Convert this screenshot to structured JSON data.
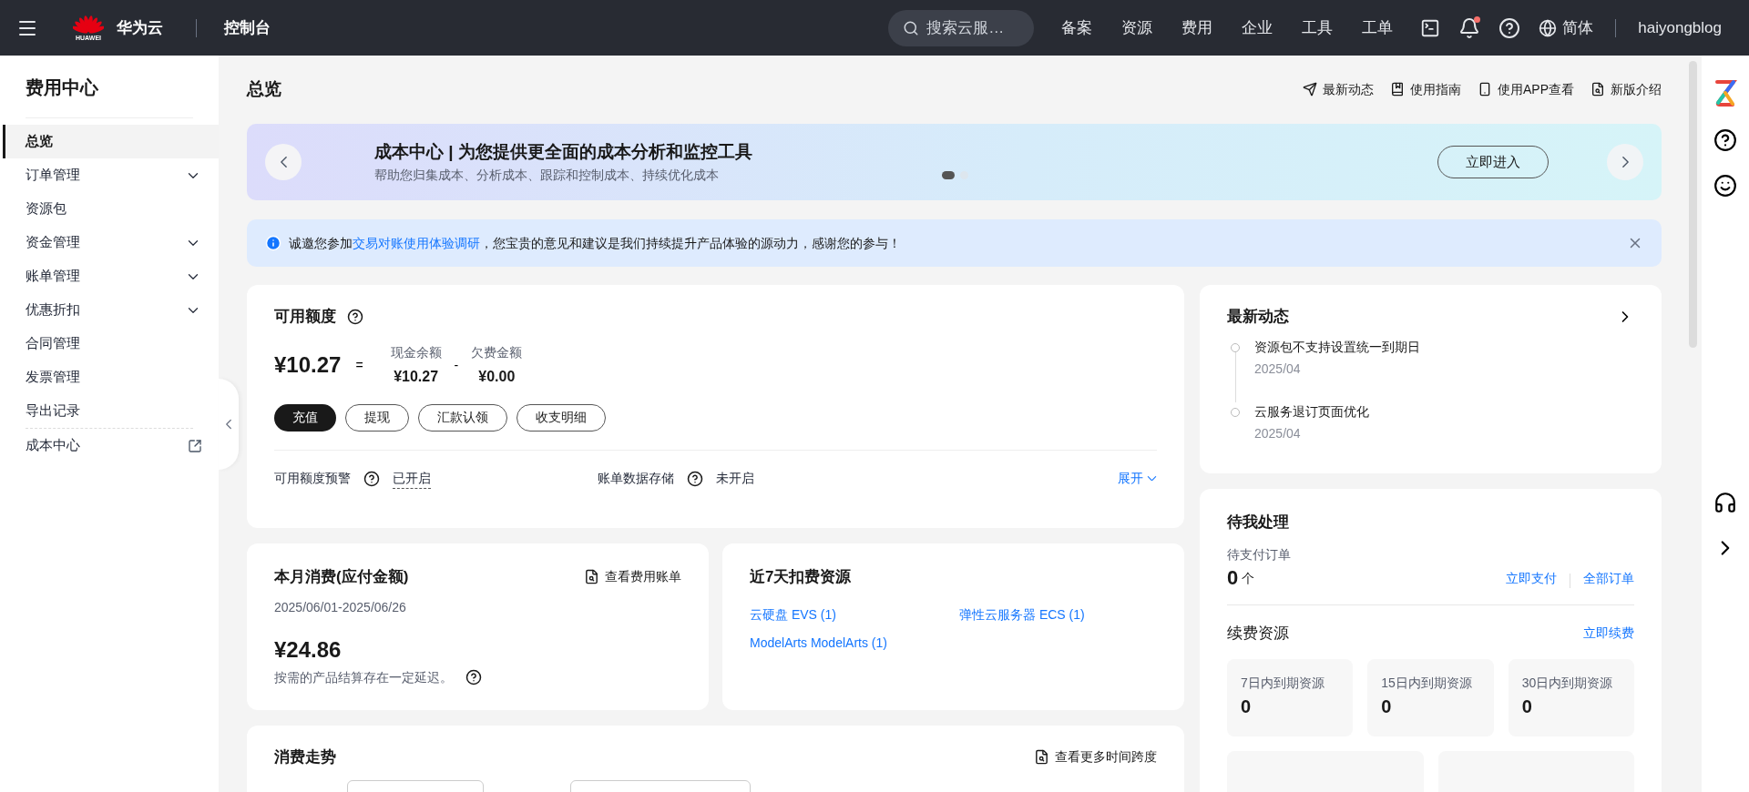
{
  "topbar": {
    "brand_mark": "HUAWEI",
    "brand": "华为云",
    "console": "控制台",
    "search": {
      "placeholder": "搜索云服…"
    },
    "nav": [
      "备案",
      "资源",
      "费用",
      "企业",
      "工具",
      "工单"
    ],
    "notifications": {
      "unread": true
    },
    "language": "简体",
    "user": "haiyongblog"
  },
  "sidebar": {
    "title": "费用中心",
    "items": [
      {
        "label": "总览",
        "kind": "plain",
        "selected": true
      },
      {
        "label": "订单管理",
        "kind": "group",
        "selected": false
      },
      {
        "label": "资源包",
        "kind": "plain",
        "selected": false
      },
      {
        "label": "资金管理",
        "kind": "group",
        "selected": false
      },
      {
        "label": "账单管理",
        "kind": "group",
        "selected": false
      },
      {
        "label": "优惠折扣",
        "kind": "group",
        "selected": false
      },
      {
        "label": "合同管理",
        "kind": "plain",
        "selected": false
      },
      {
        "label": "发票管理",
        "kind": "plain",
        "selected": false
      },
      {
        "label": "导出记录",
        "kind": "plain",
        "selected": false
      },
      {
        "label": "成本中心",
        "kind": "external",
        "selected": false
      }
    ]
  },
  "page": {
    "title": "总览",
    "header_links": [
      "最新动态",
      "使用指南",
      "使用APP查看",
      "新版介绍"
    ]
  },
  "banner": {
    "title": "成本中心 | 为您提供更全面的成本分析和监控工具",
    "subtitle": "帮助您归集成本、分析成本、跟踪和控制成本、持续优化成本",
    "button": "立即进入",
    "dots": [
      {
        "selected": true
      },
      {
        "selected": false
      }
    ]
  },
  "notice": {
    "before": "诚邀您参加",
    "link": "交易对账使用体验调研",
    "after": "，您宝贵的意见和建议是我们持续提升产品体验的源动力，感谢您的参与！"
  },
  "credit": {
    "title": "可用额度",
    "total": "¥10.27",
    "equals": "=",
    "minus": "-",
    "parts": [
      {
        "label": "现金余额",
        "value": "¥10.27"
      },
      {
        "label": "欠费金额",
        "value": "¥0.00"
      }
    ],
    "buttons": [
      {
        "label": "充值",
        "kind": "primary"
      },
      {
        "label": "提现",
        "kind": "outline"
      },
      {
        "label": "汇款认领",
        "kind": "outline"
      },
      {
        "label": "收支明细",
        "kind": "outline"
      }
    ],
    "settings": [
      {
        "label": "可用额度预警",
        "value": "已开启",
        "on": true
      },
      {
        "label": "账单数据存储",
        "value": "未开启",
        "on": false
      }
    ],
    "expand": "展开"
  },
  "monthly": {
    "title": "本月消费(应付金额)",
    "link": "查看费用账单",
    "period": "2025/06/01-2025/06/26",
    "amount": "¥24.86",
    "note": "按需的产品结算存在一定延迟。"
  },
  "recent_resources": {
    "title": "近7天扣费资源",
    "items": [
      "云硬盘 EVS (1)",
      "弹性云服务器 ECS (1)",
      "ModelArts ModelArts (1)"
    ]
  },
  "trend": {
    "title": "消费走势",
    "link": "查看更多时间跨度"
  },
  "news": {
    "title": "最新动态",
    "items": [
      {
        "title": "资源包不支持设置统一到期日",
        "date": "2025/04"
      },
      {
        "title": "云服务退订页面优化",
        "date": "2025/04"
      }
    ]
  },
  "todo": {
    "title": "待我处理",
    "pending_label": "待支付订单",
    "pending_count": "0",
    "pending_unit": "个",
    "pay_link": "立即支付",
    "orders_link": "全部订单",
    "renew_title": "续费资源",
    "renew_link": "立即续费",
    "tiles": [
      {
        "label": "7日内到期资源",
        "value": "0"
      },
      {
        "label": "15日内到期资源",
        "value": "0"
      },
      {
        "label": "30日内到期资源",
        "value": "0"
      }
    ]
  }
}
